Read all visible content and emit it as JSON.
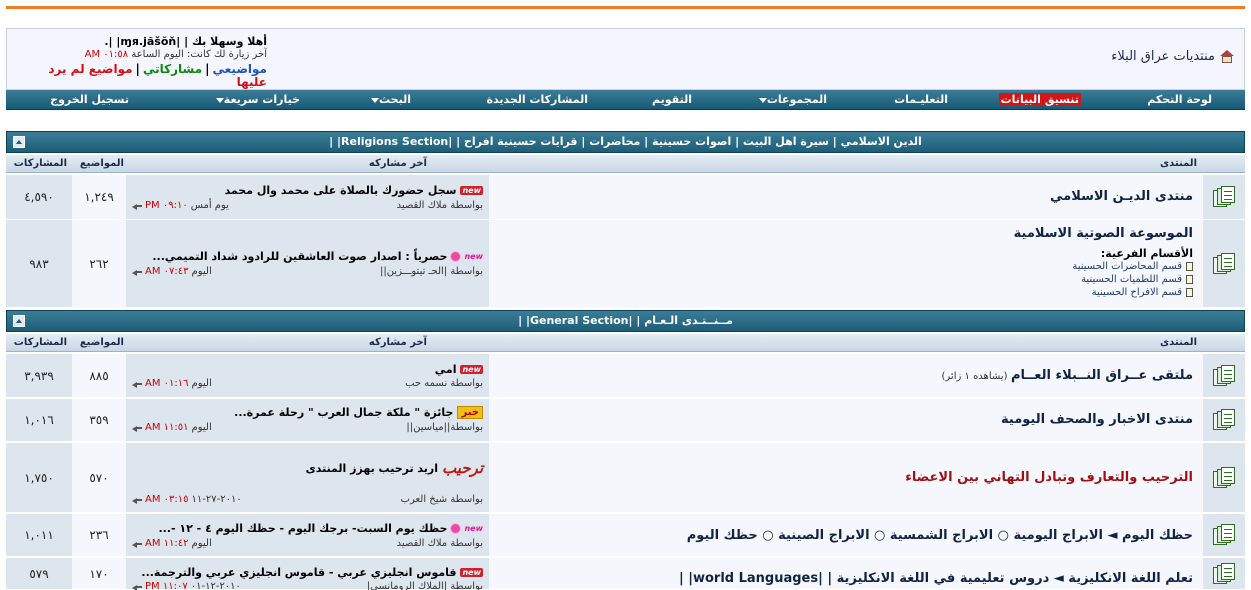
{
  "site": {
    "title": "منتديات عراق البلاء",
    "home_icon": "home-icon"
  },
  "user": {
    "welcome": "أهلا وسهلا بك | |ɱя.jăšŏň| |.",
    "last_visit_label": "آخر زيارة لك كانت: اليوم الساعة",
    "last_visit_time": "٠١:٥٨ AM",
    "links": {
      "my_threads": "مواضيعي",
      "my_posts": "مشاركاتي",
      "unanswered": "مواضيع لم يرد عليها"
    }
  },
  "nav": {
    "control_panel": "لوحة التحكم",
    "format": "تنسيق البيانات",
    "instructions": "التعليـمات",
    "groups": "المجموعات",
    "calendar": "التقويم",
    "new_posts": "المشاركات الجديدة",
    "search": "البحث",
    "quick_options": "خيارات سريعة",
    "logout": "تسجيل الخروج"
  },
  "columns": {
    "forum": "المنتدى",
    "last_post": "آخر مشاركه",
    "threads": "المواضيع",
    "posts": "المشاركات"
  },
  "categories": [
    {
      "title": "الدين الاسلامي | سيرة اهل البيت | اصوات حسينية | محاضرات | قرايات حسينية افراح | |Religions Section| |",
      "forums": [
        {
          "name": "منتدى الديـن الاسلامي",
          "last_title": "سجل حضورك بالصلاة على محمد وال محمد",
          "last_badge": "new",
          "last_by": "بواسطة ملاك القصيد",
          "last_date": "يوم أمس",
          "last_time": "٠٩:١٠ PM",
          "threads": "١,٢٤٩",
          "posts": "٤,٥٩٠"
        },
        {
          "name": "الموسوعة الصوتية الاسلامية",
          "sub_head": "الأقسام الفرعية:",
          "sub_items": [
            "قسم المحاضرات الحسينية",
            "قسم اللطميات الحسينية",
            "قسم الافراح الحسينية"
          ],
          "last_title": "حصرياً : اصدار صوت العاشقين للرادود شداد التميمي...",
          "last_badge": "new",
          "last_by": "بواسطة |الحـ تيتوـــزين||",
          "last_date": "اليوم",
          "last_time": "٠٧:٤٣ AM",
          "threads": "٢٦٢",
          "posts": "٩٨٣"
        }
      ]
    },
    {
      "title": "مــنــتـدى الـعـام | |General Section| |",
      "forums": [
        {
          "name": "ملتقى عــراق النــبلاء العــام",
          "viewing": "(يشاهده ١ زائر)",
          "last_title": "امي",
          "last_badge": "new",
          "last_by": "بواسطة نسمه حب",
          "last_date": "اليوم",
          "last_time": "٠١:١٦ AM",
          "threads": "٨٨٥",
          "posts": "٣,٩٣٩"
        },
        {
          "name": "منتدى الاخبار والصحف اليومية",
          "last_title": "جائزة \" ملكة جمال العرب \" رحلة عمرة...",
          "last_badge": "خبر",
          "last_by": "بواسطة||مياسين||",
          "last_date": "اليوم",
          "last_time": "١١:٥١ AM",
          "threads": "٣٥٩",
          "posts": "١,٠١٦"
        },
        {
          "name": "الترحيب والتعارف وتبادل التهاني بين الاعضاء",
          "last_title": "اريد ترحيب بهزز المنتدى",
          "last_badge": "ترحيب",
          "last_by": "بواسطة شيخ العرب",
          "last_date": "٢٠١٠-٢٧-١١",
          "last_time": "٠٣:١٥ AM",
          "threads": "٥٧٠",
          "posts": "١,٧٥٠"
        },
        {
          "name": "حظك اليوم ◄ الابراج اليومية ○ الابراج الشمسية ○ الابراج الصينية ○ حظك اليوم",
          "last_title": "حظك يوم السبت- برجك اليوم - حظك اليوم ٤ - ١٢ -...",
          "last_badge": "new",
          "last_by": "بواسطة ملاك القصيد",
          "last_date": "اليوم",
          "last_time": "١١:٤٢ AM",
          "threads": "٢٣٦",
          "posts": "١,٠١١"
        },
        {
          "name": "تعلم اللغة الانكليزية ◄ دروس تعليمية في اللغة الانكليزية | |world Languages| |",
          "last_title": "قاموس انجليزي عربي - قاموس انجليزي عربي والترجمة...",
          "last_badge": "new",
          "last_by": "بواسطة |الملاك الرومانسي|",
          "last_date": "٢٠١٠-١٢-٠١",
          "last_time": "١١:٠٧ PM",
          "threads": "١٧٠",
          "posts": "٥٧٩"
        }
      ]
    }
  ]
}
